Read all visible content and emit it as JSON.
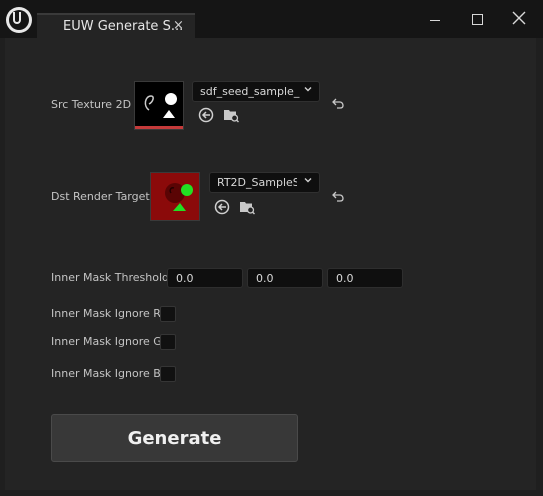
{
  "window": {
    "tab_title": "EUW Generate S...",
    "tab_close": "×"
  },
  "src": {
    "label": "Src Texture 2D",
    "asset": "sdf_seed_sample_"
  },
  "dst": {
    "label": "Dst Render Target",
    "asset": "RT2D_SampleS"
  },
  "threshold": {
    "label": "Inner Mask Threshold",
    "values": [
      "0.0",
      "0.0",
      "0.0"
    ]
  },
  "ignore": {
    "r": "Inner Mask Ignore R",
    "g": "Inner Mask Ignore G",
    "b": "Inner Mask Ignore B"
  },
  "generate_label": "Generate"
}
